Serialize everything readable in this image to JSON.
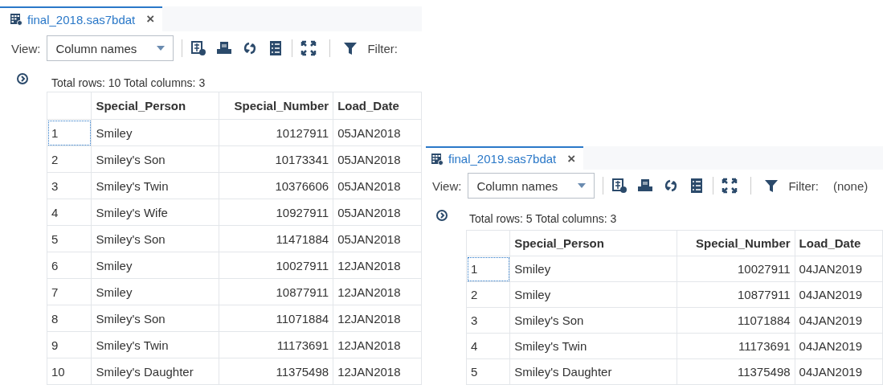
{
  "panels": [
    {
      "tab": {
        "title": "final_2018.sas7bdat",
        "close": "×"
      },
      "view_label": "View:",
      "view_value": "Column names",
      "filter_label": "Filter:",
      "total": "Total rows: 10  Total columns: 3",
      "columns": [
        "Special_Person",
        "Special_Number",
        "Load_Date"
      ],
      "rows": [
        {
          "n": "1",
          "person": "Smiley",
          "number": "10127911",
          "date": "05JAN2018",
          "focused": true
        },
        {
          "n": "2",
          "person": "Smiley's Son",
          "number": "10173341",
          "date": "05JAN2018",
          "focused": false
        },
        {
          "n": "3",
          "person": "Smiley's Twin",
          "number": "10376606",
          "date": "05JAN2018",
          "focused": false
        },
        {
          "n": "4",
          "person": "Smiley's Wife",
          "number": "10927911",
          "date": "05JAN2018",
          "focused": false
        },
        {
          "n": "5",
          "person": "Smiley's Son",
          "number": "11471884",
          "date": "05JAN2018",
          "focused": false
        },
        {
          "n": "6",
          "person": "Smiley",
          "number": "10027911",
          "date": "12JAN2018",
          "focused": false
        },
        {
          "n": "7",
          "person": "Smiley",
          "number": "10877911",
          "date": "12JAN2018",
          "focused": false
        },
        {
          "n": "8",
          "person": "Smiley's Son",
          "number": "11071884",
          "date": "12JAN2018",
          "focused": false
        },
        {
          "n": "9",
          "person": "Smiley's Twin",
          "number": "11173691",
          "date": "12JAN2018",
          "focused": false
        },
        {
          "n": "10",
          "person": "Smiley's Daughter",
          "number": "11375498",
          "date": "12JAN2018",
          "focused": false
        }
      ]
    },
    {
      "tab": {
        "title": "final_2019.sas7bdat",
        "close": "×"
      },
      "view_label": "View:",
      "view_value": "Column names",
      "filter_label": "Filter:",
      "filter_value": "(none)",
      "total": "Total rows: 5  Total columns: 3",
      "columns": [
        "Special_Person",
        "Special_Number",
        "Load_Date"
      ],
      "rows": [
        {
          "n": "1",
          "person": "Smiley",
          "number": "10027911",
          "date": "04JAN2019",
          "focused": true
        },
        {
          "n": "2",
          "person": "Smiley",
          "number": "10877911",
          "date": "04JAN2019",
          "focused": false
        },
        {
          "n": "3",
          "person": "Smiley's Son",
          "number": "11071884",
          "date": "04JAN2019",
          "focused": false
        },
        {
          "n": "4",
          "person": "Smiley's Twin",
          "number": "11173691",
          "date": "04JAN2019",
          "focused": false
        },
        {
          "n": "5",
          "person": "Smiley's Daughter",
          "number": "11375498",
          "date": "04JAN2019",
          "focused": false
        }
      ]
    }
  ]
}
